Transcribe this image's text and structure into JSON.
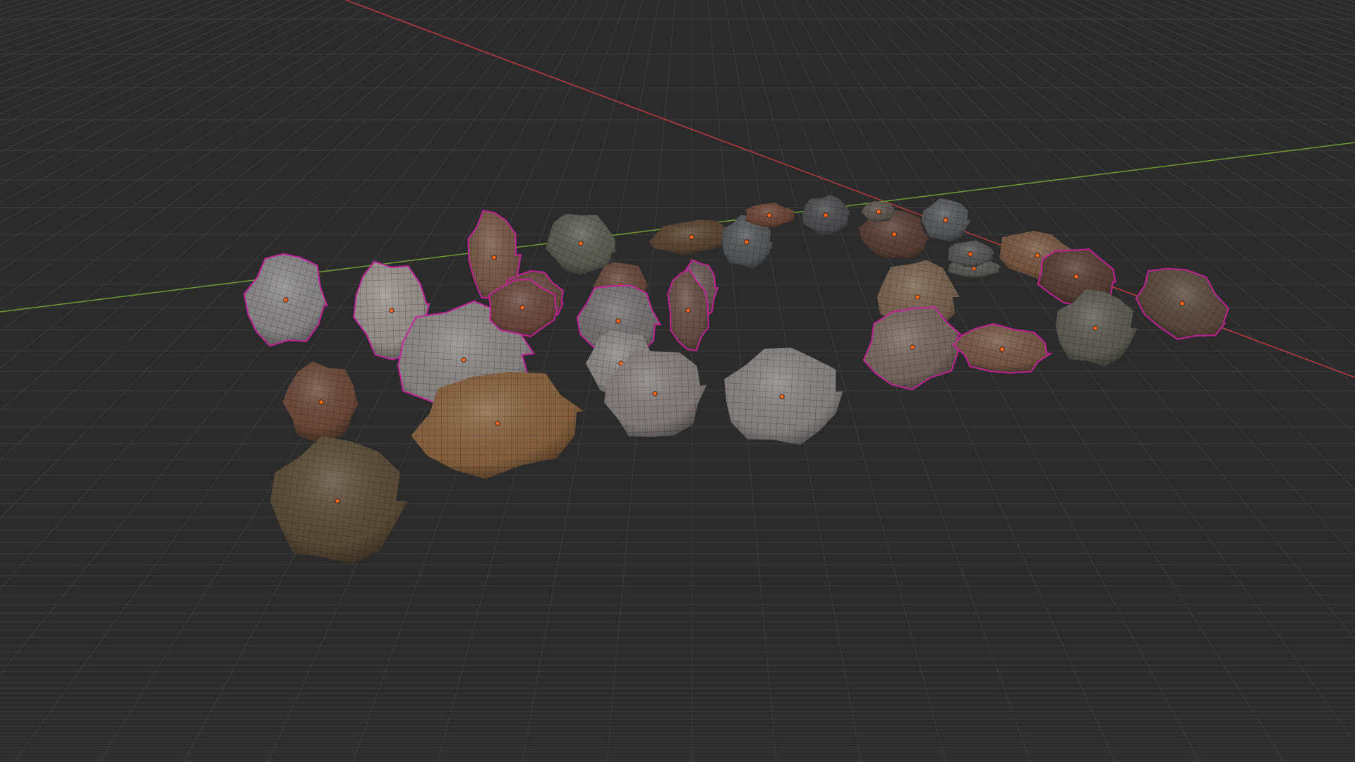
{
  "viewport": {
    "background": "#2b2b2b",
    "grid_color": "#3c3c3c",
    "x_axis_color": "#b33a3a",
    "y_axis_color": "#6e9c34",
    "selection_outline_color": "#c8209c",
    "origin_dot_color": "#ff6a1a",
    "grid": "on",
    "shading": "textured",
    "overlay": "wireframe"
  },
  "scene": {
    "object_type": "rock",
    "object_count": 33,
    "all_selected": true
  }
}
